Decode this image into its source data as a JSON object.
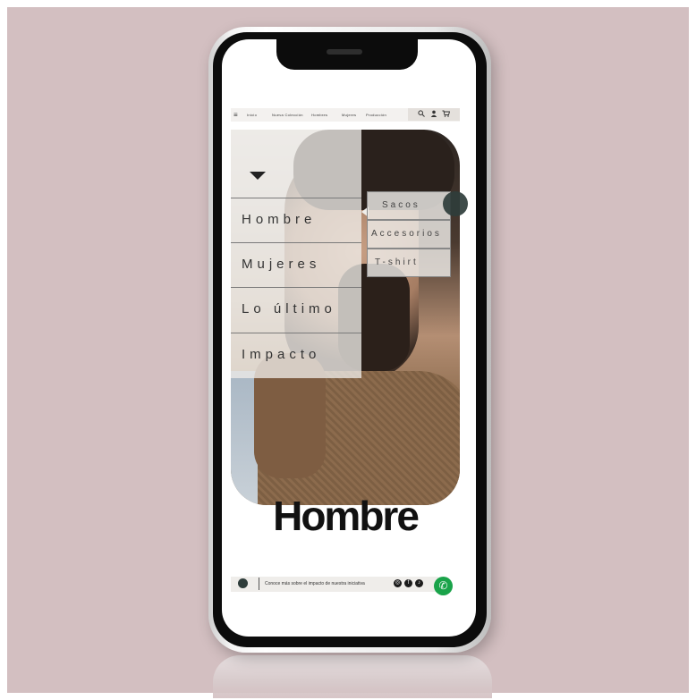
{
  "nav": {
    "menu_icon": "hamburger-icon",
    "links": [
      "Inicio",
      "Nueva Colección",
      "Hombres",
      "Mujeres",
      "Producción"
    ],
    "icons": [
      "search-icon",
      "user-icon",
      "cart-icon"
    ]
  },
  "menu": {
    "items": [
      "Hombre",
      "Mujeres",
      "Lo último",
      "Impacto"
    ],
    "submenu": [
      "Sacos",
      "Accesorios",
      "T-shirt"
    ]
  },
  "hero": {
    "title": "Hombre"
  },
  "footer": {
    "text": "Conoce más sobre el impacto de nuestra iniciativa",
    "social_icons": [
      "instagram-icon",
      "facebook-icon",
      "tiktok-icon"
    ],
    "whatsapp_icon": "whatsapp-icon"
  },
  "colors": {
    "background": "#d3bfc1",
    "accent": "#2f3d3b",
    "whatsapp": "#1aa34a"
  }
}
